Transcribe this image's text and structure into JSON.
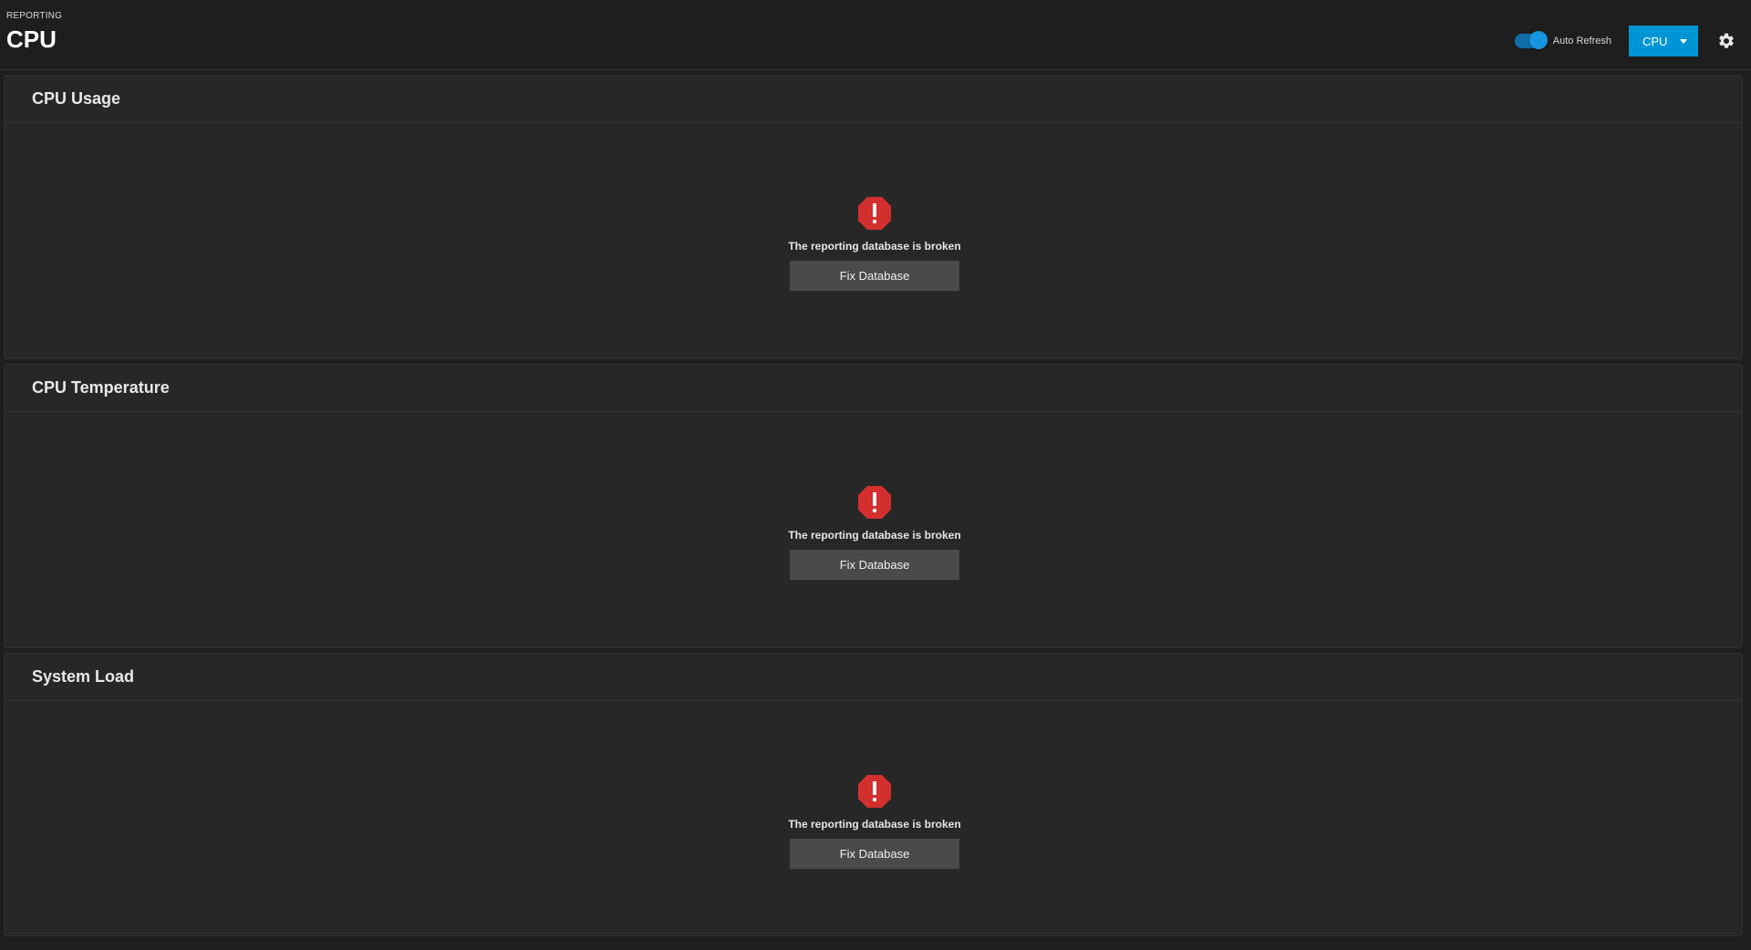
{
  "header": {
    "breadcrumb": "REPORTING",
    "title": "CPU",
    "auto_refresh_label": "Auto Refresh",
    "auto_refresh_on": true,
    "report_select_value": "CPU",
    "accent_color": "#0095d5"
  },
  "cards": [
    {
      "title": "CPU Usage",
      "error_icon": "error-octagon-icon",
      "error_message": "The reporting database is broken",
      "button_label": "Fix Database"
    },
    {
      "title": "CPU Temperature",
      "error_icon": "error-octagon-icon",
      "error_message": "The reporting database is broken",
      "button_label": "Fix Database"
    },
    {
      "title": "System Load",
      "error_icon": "error-octagon-icon",
      "error_message": "The reporting database is broken",
      "button_label": "Fix Database"
    }
  ],
  "colors": {
    "background": "#1e1e1e",
    "card": "#272727",
    "error": "#d32f2f",
    "button": "#4a4a4a"
  }
}
